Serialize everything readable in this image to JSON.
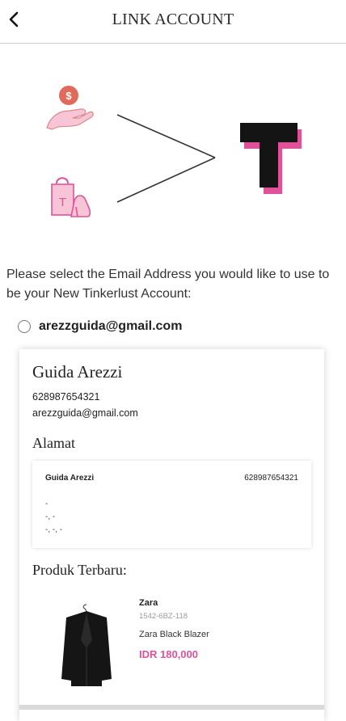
{
  "header": {
    "title": "LINK ACCOUNT",
    "back_icon": "chevron-left-icon"
  },
  "illustration": {
    "icons": [
      "money-hand-icon",
      "shopping-bag-heels-icon",
      "tinkerlust-logo"
    ],
    "logo_letter": "T",
    "bag_letter": "T",
    "accent_color": "#e0519a",
    "pink_light": "#f7c5d6"
  },
  "prompt": "Please select the Email Address you would like to use to be your New Tinkerlust Account:",
  "email_option": {
    "label": "arezzguida@gmail.com",
    "selected": false
  },
  "account": {
    "name": "Guida Arezzi",
    "phone": "628987654321",
    "email": "arezzguida@gmail.com",
    "address_section_title": "Alamat",
    "address": {
      "name": "Guida Arezzi",
      "phone": "628987654321",
      "lines": [
        "-",
        "-, -",
        "-, -, -"
      ]
    },
    "products_section_title": "Produk Terbaru:",
    "product": {
      "brand": "Zara",
      "sku": "1542-6BZ-118",
      "name": "Zara Black Blazer",
      "price": "IDR 180,000"
    }
  }
}
